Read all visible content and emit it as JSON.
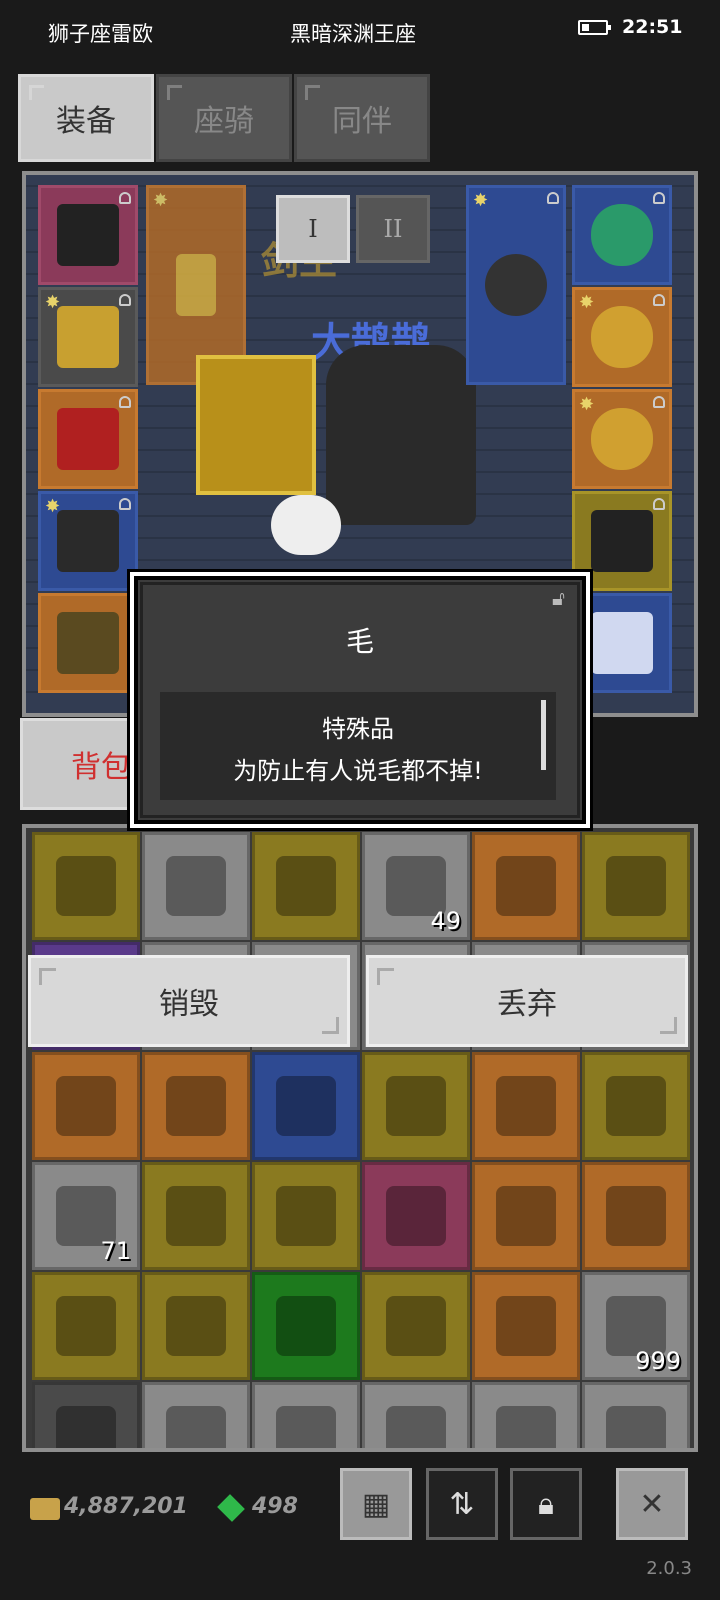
{
  "status_bar": {
    "left_text": "狮子座雷欧",
    "center_text": "黑暗深渊王座",
    "time": "22:51"
  },
  "tabs": [
    {
      "label": "装备",
      "active": true
    },
    {
      "label": "座骑",
      "active": false
    },
    {
      "label": "同伴",
      "active": false
    }
  ],
  "equip_panel": {
    "page_buttons": [
      "I",
      "II"
    ],
    "character_name": "大鹊鹊",
    "character_title": "剑主"
  },
  "bag_tab": {
    "label": "背包"
  },
  "dialog": {
    "title": "毛",
    "lines": [
      "特殊品",
      "为防止有人说毛都不掉!"
    ]
  },
  "actions": {
    "destroy": "销毁",
    "discard": "丢弃"
  },
  "inventory": {
    "cells": [
      {
        "color": "#8a7a20",
        "icon": "red-feather-icon",
        "qty": ""
      },
      {
        "color": "#8a8a8a",
        "icon": "hook-icon",
        "qty": ""
      },
      {
        "color": "#8a7a20",
        "icon": "bow-icon",
        "qty": ""
      },
      {
        "color": "#8a8a8a",
        "icon": "red-potion-icon",
        "qty": "49"
      },
      {
        "color": "#b06a28",
        "icon": "bracer-icon",
        "qty": ""
      },
      {
        "color": "#8a7a20",
        "icon": "boots-icon",
        "qty": ""
      },
      {
        "color": "#5a3a8a",
        "icon": "item-icon",
        "qty": ""
      },
      {
        "color": "#8a8a8a",
        "icon": "item-icon",
        "qty": ""
      },
      {
        "color": "#8a8a8a",
        "icon": "item-icon",
        "qty": ""
      },
      {
        "color": "#8a8a8a",
        "icon": "item-icon",
        "qty": ""
      },
      {
        "color": "#8a8a8a",
        "icon": "item-icon",
        "qty": ""
      },
      {
        "color": "#8a8a8a",
        "icon": "item-icon",
        "qty": ""
      },
      {
        "color": "#b06a28",
        "icon": "green-glove-icon",
        "qty": ""
      },
      {
        "color": "#b06a28",
        "icon": "card-icon",
        "qty": ""
      },
      {
        "color": "#2e4a92",
        "icon": "crown-icon",
        "qty": ""
      },
      {
        "color": "#8a7a20",
        "icon": "chest-armor-icon",
        "qty": ""
      },
      {
        "color": "#b06a28",
        "icon": "green-glove-icon",
        "qty": ""
      },
      {
        "color": "#8a7a20",
        "icon": "bow-icon",
        "qty": ""
      },
      {
        "color": "#8a8a8a",
        "icon": "meat-icon",
        "qty": "71"
      },
      {
        "color": "#8a7a20",
        "icon": "spear-icon",
        "qty": ""
      },
      {
        "color": "#8a7a20",
        "icon": "spear-icon",
        "qty": ""
      },
      {
        "color": "#8b3a5a",
        "icon": "spear-icon",
        "qty": ""
      },
      {
        "color": "#b06a28",
        "icon": "brown-glove-icon",
        "qty": ""
      },
      {
        "color": "#b06a28",
        "icon": "red-amulet-icon",
        "qty": ""
      },
      {
        "color": "#8a7a20",
        "icon": "chest-armor-icon",
        "qty": ""
      },
      {
        "color": "#8a7a20",
        "icon": "red-staff-icon",
        "qty": ""
      },
      {
        "color": "#1d7a1d",
        "icon": "green-helmet-icon",
        "qty": ""
      },
      {
        "color": "#8a7a20",
        "icon": "boots-icon",
        "qty": ""
      },
      {
        "color": "#b06a28",
        "icon": "brown-boots-icon",
        "qty": ""
      },
      {
        "color": "#8a8a8a",
        "icon": "meat-icon",
        "qty": "999"
      },
      {
        "color": "#4a4a4a",
        "icon": "gem-belt-icon",
        "qty": ""
      },
      {
        "color": "#8a8a8a",
        "icon": "fish-icon",
        "qty": ""
      },
      {
        "color": "#8a8a8a",
        "icon": "meat-icon",
        "qty": ""
      },
      {
        "color": "#8a8a8a",
        "icon": "red-cap-icon",
        "qty": ""
      },
      {
        "color": "#8a8a8a",
        "icon": "blue-cap-icon",
        "qty": ""
      },
      {
        "color": "#8a8a8a",
        "icon": "meat-icon",
        "qty": ""
      }
    ]
  },
  "currency": {
    "gold": "4,887,201",
    "gems": "498"
  },
  "version": "2.0.3"
}
